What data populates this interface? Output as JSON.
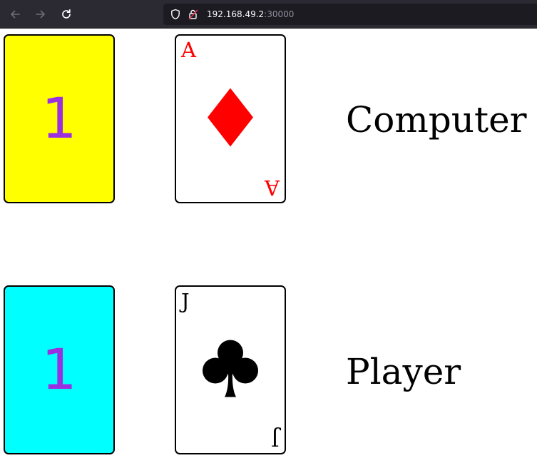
{
  "browser": {
    "url_host": "192.168.49.2",
    "url_port": ":30000",
    "icons": {
      "back": "back-arrow-icon",
      "forward": "forward-arrow-icon",
      "reload": "reload-icon",
      "shield": "shield-icon",
      "lock": "insecure-lock-icon"
    }
  },
  "computer": {
    "label": "Computer",
    "count": "1",
    "count_card_color": "#ffff00",
    "count_text_color": "#9b30e0",
    "card": {
      "rank": "A",
      "suit": "diamonds",
      "suit_color": "#ff0000"
    }
  },
  "player": {
    "label": "Player",
    "count": "1",
    "count_card_color": "#00ffff",
    "count_text_color": "#9b30e0",
    "card": {
      "rank": "J",
      "suit": "clubs",
      "suit_color": "#000000"
    }
  }
}
